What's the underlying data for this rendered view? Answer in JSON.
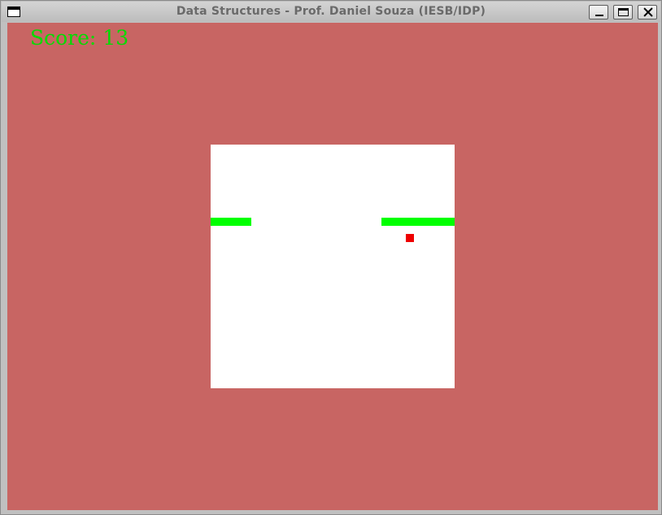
{
  "window": {
    "title": "Data Structures - Prof. Daniel Souza (IESB/IDP)",
    "controls": [
      "minimize",
      "maximize",
      "close"
    ]
  },
  "game": {
    "background_color": "#c86563",
    "board_color": "#ffffff",
    "snake_color": "#00ff00",
    "food_color": "#ee0000",
    "score": {
      "label": "Score:",
      "value": "13",
      "color": "#00dd00"
    }
  }
}
